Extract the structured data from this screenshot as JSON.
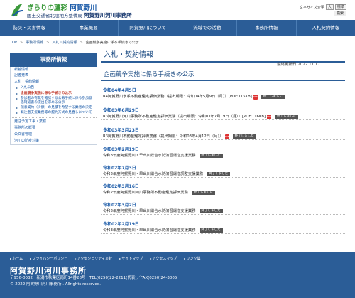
{
  "header": {
    "logo_main_prefix": "ぎらりの蘆彩",
    "logo_main_suffix": "阿賀野川",
    "logo_sub_org": "国土交通省北陸地方整備局",
    "logo_sub_office": "阿賀野川河川事務所",
    "fontsize_label": "文字サイズ変更",
    "fontsize_large": "大",
    "fontsize_normal": "標準",
    "search_button": "検索"
  },
  "nav": [
    "防災・災害情報",
    "事業概要",
    "阿賀野川について",
    "流域での活動",
    "事務所情報",
    "入札契約情報"
  ],
  "breadcrumb": {
    "top": "TOP",
    "office": "事務所情報",
    "bid": "入札・契約情報",
    "current": "企画競争実施に係る手続きの公示"
  },
  "sidebar": {
    "heading": "事務所情報",
    "links_a": [
      "新着情報",
      "記者発表",
      "入札・契約情報"
    ],
    "subs": [
      "入札公告",
      "企画競争実施に係る手続きの公示",
      "参加者の有無を確認する公募手続に係る参加意思確認書の提出を求める公示",
      "随意契約（少額）の見積を希望する業者の決定",
      "発注者支援業務等の契約方式の見直しについて"
    ],
    "links_b": [
      "発注予定工事・業務",
      "事務所の概要",
      "公文書管理",
      "河川の防疫対策"
    ]
  },
  "main": {
    "title": "入札・契約情報",
    "updated": "最終更新日:2022.11.17",
    "subtitle": "企画競争実施に係る手続きの公示",
    "done_label": "終了しました",
    "entries": [
      {
        "date": "令和04年4月5日",
        "text": "R4阿賀野川水系不動産鑑定評価業務（提出期限：令和04年5月9日（月））[PDF:115KB]",
        "pdf": true
      },
      {
        "date": "令和03年6月29日",
        "text": "R3阿賀野川河川事務所不動産鑑定評価業務（提出期限：令和03年7月19日（月））[PDF:116KB]",
        "pdf": true
      },
      {
        "date": "令和03年3月23日",
        "text": "R3阿賀野川不動産鑑定評価業務（提出期限：令和03年4月12日（月））",
        "pdf": true
      },
      {
        "date": "令和03年2月19日",
        "text": "令和3年度阿賀野川・早出川総合水防演習運営支援業務",
        "pdf": false
      },
      {
        "date": "令和02年7月3日",
        "text": "令和2年度阿賀野川・早出川総合水防演習運営調整支援業務",
        "pdf": false
      },
      {
        "date": "令和02年3月16日",
        "text": "令和2年度阿賀野川河川事務所不動産鑑定評価業務",
        "pdf": false
      },
      {
        "date": "令和02年3月2日",
        "text": "令和2年度阿賀野川・早出川総合水防演習運営支援業務",
        "pdf": false
      },
      {
        "date": "令和02年2月19日",
        "text": "令和3年度阿賀野川・早出川総合水防演習運営支援業務",
        "pdf": false
      }
    ]
  },
  "footer": {
    "links": [
      "ホーム",
      "プライバシーポリシー",
      "アクセシビリティ方針",
      "サイトマップ",
      "アクセスマップ",
      "リンク集"
    ],
    "name": "阿賀野川河川事務所",
    "address": "〒956-0032　新潟市秋葉区南町14番28号　TEL(0250)22-2211(代表)／FAX(0250)24-3005",
    "copyright": "© 2022 阿賀野川河川事務所 . Allrights reserved."
  },
  "colors": {
    "nav_bg": "#2b5d97",
    "accent_green": "#3c9a3c",
    "done_badge": "#555555"
  }
}
